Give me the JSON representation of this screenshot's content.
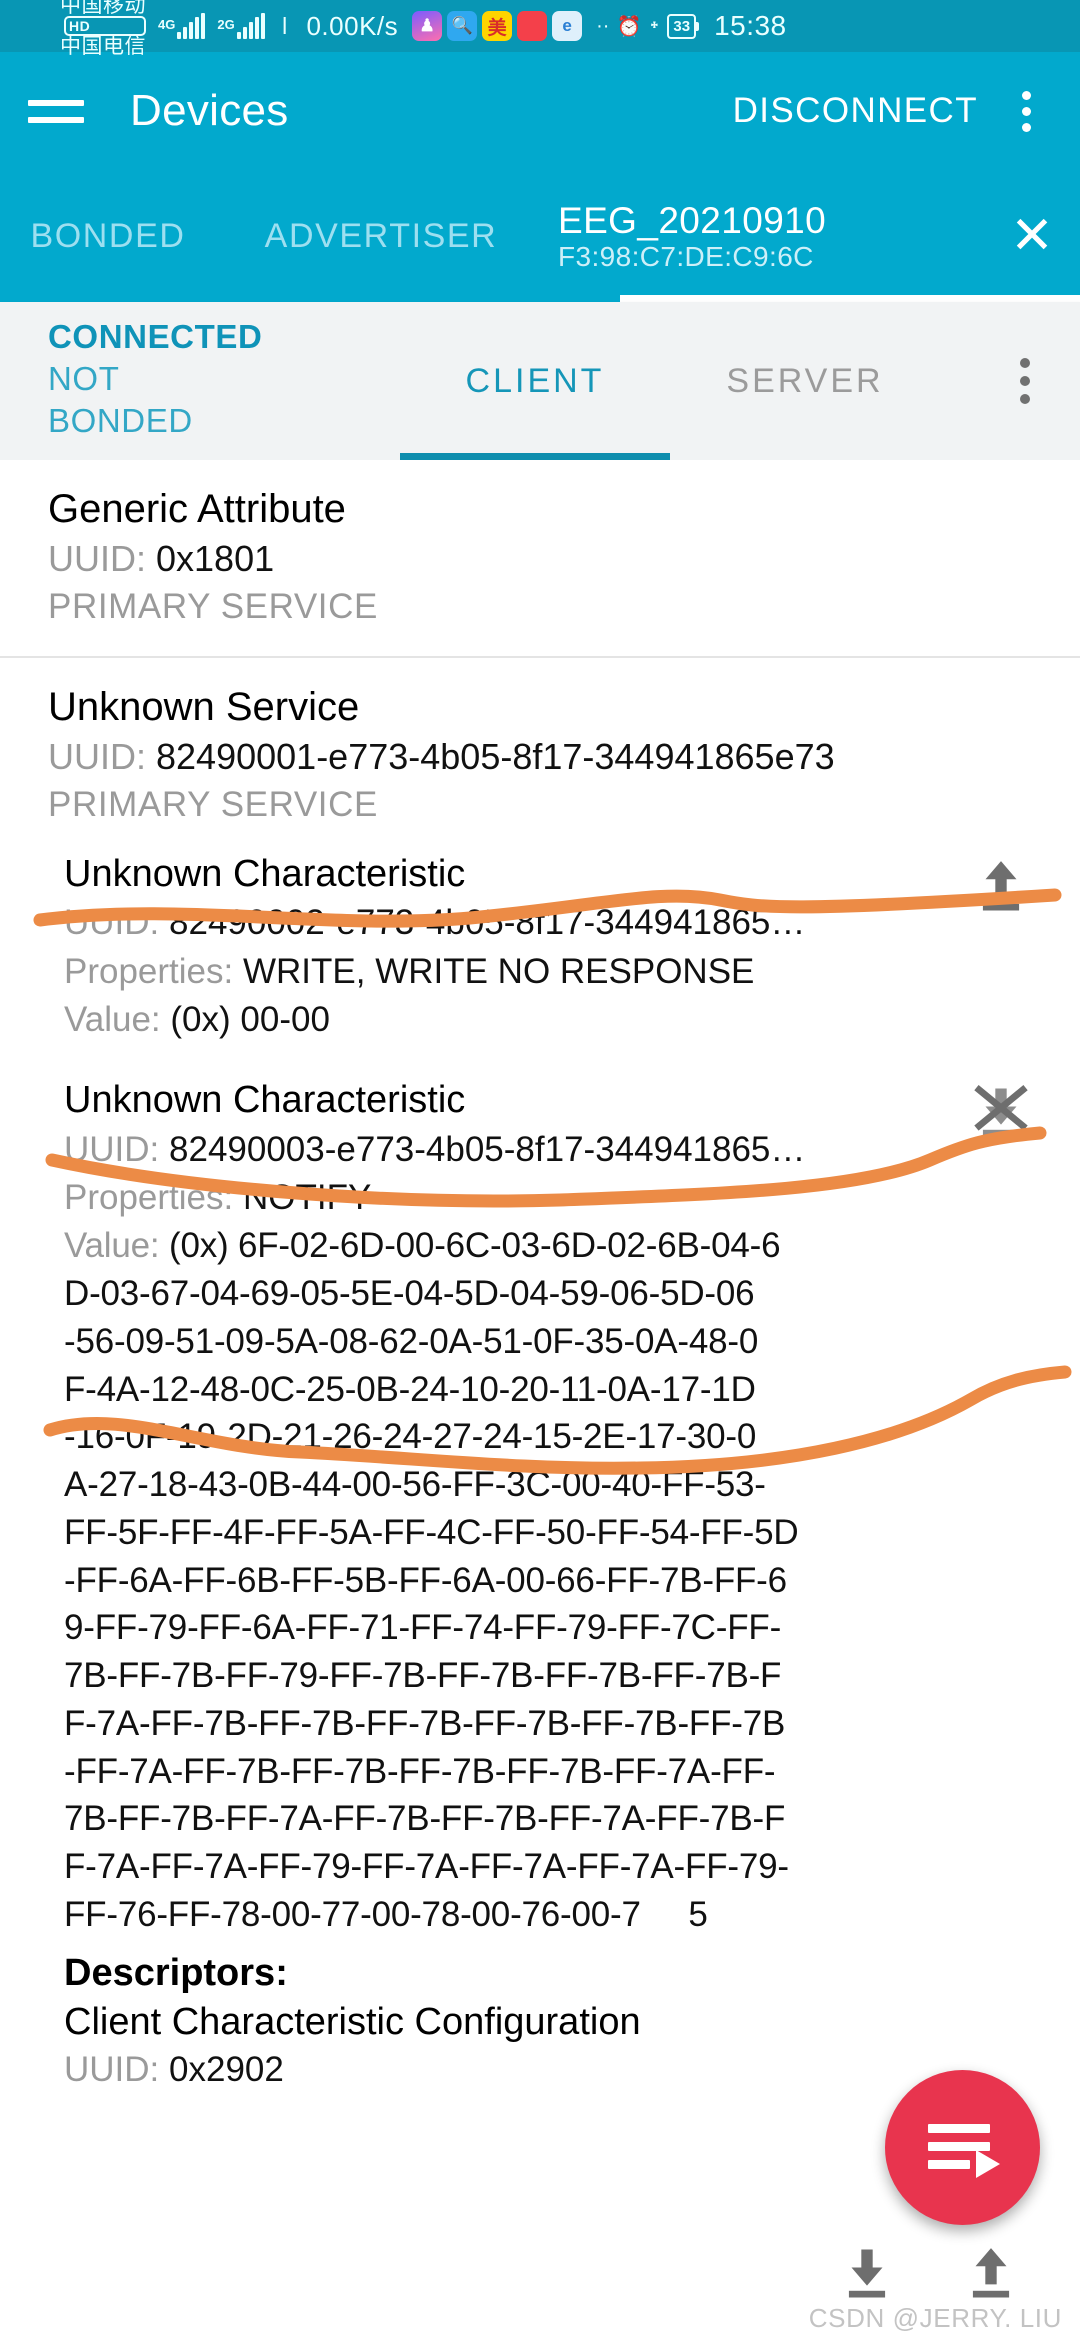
{
  "statusbar": {
    "carrier_line1": "中国移动",
    "hd_badge": "HD",
    "carrier_line2": "中国电信",
    "net1": "4G",
    "net2": "2G",
    "speed": "0.00K/s",
    "app_icon_1": "photo-icon",
    "app_icon_2": "search-icon",
    "app_icon_3": "美",
    "app_icon_4": "book-icon",
    "app_icon_5": "e-icon",
    "more_dots": "··",
    "alarm_icon": "alarm-off-icon",
    "bluetooth_icon": "bluetooth-icon",
    "battery": "33",
    "clock": "15:38"
  },
  "appbar": {
    "menu_icon": "hamburger-icon",
    "title": "Devices",
    "disconnect_label": "DISCONNECT",
    "overflow_icon": "kebab-icon"
  },
  "device_tabs": {
    "bonded": "BONDED",
    "advertiser": "ADVERTISER",
    "active_name": "EEG_20210910",
    "active_addr": "F3:98:C7:DE:C9:6C",
    "close_icon": "✕"
  },
  "connection": {
    "state_line1": "CONNECTED",
    "state_line2": "NOT",
    "state_line3": "BONDED",
    "tab_client": "CLIENT",
    "tab_server": "SERVER",
    "overflow_icon": "kebab-icon"
  },
  "services": [
    {
      "name": "Generic Attribute",
      "uuid_label": "UUID:",
      "uuid": "0x1801",
      "type": "PRIMARY SERVICE"
    },
    {
      "name": "Unknown Service",
      "uuid_label": "UUID:",
      "uuid": "82490001-e773-4b05-8f17-344941865e73",
      "type": "PRIMARY SERVICE"
    }
  ],
  "characteristics": [
    {
      "name": "Unknown Characteristic",
      "uuid_label": "UUID:",
      "uuid": "82490002-e773-4b05-8f17-344941865…",
      "properties_label": "Properties:",
      "properties": "WRITE, WRITE NO RESPONSE",
      "value_label": "Value:",
      "value": "(0x) 00-00",
      "icon": "upload-write-icon"
    },
    {
      "name": "Unknown Characteristic",
      "uuid_label": "UUID:",
      "uuid": "82490003-e773-4b05-8f17-344941865…",
      "properties_label": "Properties:",
      "properties": "NOTIFY",
      "value_label": "Value:",
      "icon": "notify-disable-icon",
      "value_prefix": "(0x) ",
      "value_lines": [
        "6F-02-6D-00-6C-03-6D-02-6B-04-6",
        "D-03-67-04-69-05-5E-04-5D-04-59-06-5D-06",
        "-56-09-51-09-5A-08-62-0A-51-0F-35-0A-48-0",
        "F-4A-12-48-0C-25-0B-24-10-20-11-0A-17-1D",
        "-16-0F-19-2D-21-26-24-27-24-15-2E-17-30-0",
        "A-27-18-43-0B-44-00-56-FF-3C-00-40-FF-53-",
        "FF-5F-FF-4F-FF-5A-FF-4C-FF-50-FF-54-FF-5D",
        "-FF-6A-FF-6B-FF-5B-FF-6A-00-66-FF-7B-FF-6",
        "9-FF-79-FF-6A-FF-71-FF-74-FF-79-FF-7C-FF-",
        "7B-FF-7B-FF-79-FF-7B-FF-7B-FF-7B-FF-7B-F",
        "F-7A-FF-7B-FF-7B-FF-7B-FF-7B-FF-7B-FF-7B",
        "-FF-7A-FF-7B-FF-7B-FF-7B-FF-7B-FF-7A-FF-",
        "7B-FF-7B-FF-7A-FF-7B-FF-7B-FF-7A-FF-7B-F",
        "F-7A-FF-7A-FF-79-FF-7A-FF-7A-FF-7A-FF-79-",
        "FF-76-FF-78-00-77-00-78-00-76-00-7     5"
      ],
      "descriptors_label": "Descriptors:",
      "descriptor_name": "Client Characteristic Configuration",
      "descriptor_uuid_label": "UUID:",
      "descriptor_uuid": "0x2902"
    }
  ],
  "fab": {
    "icon": "log-play-icon",
    "color": "#e8344e"
  },
  "bottom_icons": {
    "download_icon": "download-read-icon",
    "upload_icon": "upload-write-icon"
  },
  "watermark": "CSDN @JERRY. LIU",
  "colors": {
    "statusbar": "#0896b4",
    "appbar": "#02a9cd",
    "accent_teal": "#0f93b8",
    "annotation_orange": "#ec8b46",
    "fab_red": "#e8344e"
  }
}
